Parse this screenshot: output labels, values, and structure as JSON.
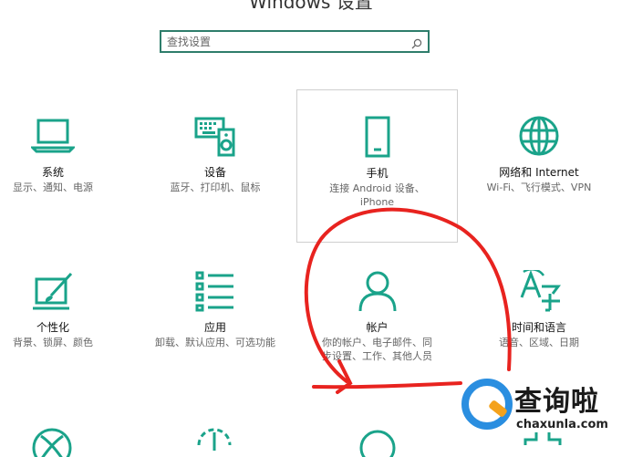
{
  "window": {
    "title": "Windows 设置"
  },
  "search": {
    "placeholder": "查找设置"
  },
  "tiles": [
    {
      "name": "系统",
      "desc": "显示、通知、电源",
      "icon": "laptop-icon"
    },
    {
      "name": "设备",
      "desc": "蓝牙、打印机、鼠标",
      "icon": "devices-icon"
    },
    {
      "name": "手机",
      "desc": "连接 Android 设备、iPhone",
      "icon": "phone-icon"
    },
    {
      "name": "网络和 Internet",
      "desc": "Wi-Fi、飞行模式、VPN",
      "icon": "globe-icon"
    },
    {
      "name": "个性化",
      "desc": "背景、锁屏、颜色",
      "icon": "personalize-icon"
    },
    {
      "name": "应用",
      "desc": "卸载、默认应用、可选功能",
      "icon": "apps-list-icon"
    },
    {
      "name": "帐户",
      "desc": "你的帐户、电子邮件、同步设置、工作、其他人员",
      "icon": "person-icon"
    },
    {
      "name": "时间和语言",
      "desc": "语音、区域、日期",
      "icon": "time-language-icon"
    }
  ],
  "watermark": {
    "brand": "查询啦",
    "domain": "chaxunla.com"
  },
  "colors": {
    "accent": "#1aa38a",
    "annotation": "#e8231f",
    "logo_blue": "#2a8ee0",
    "logo_orange": "#f4a21c"
  }
}
